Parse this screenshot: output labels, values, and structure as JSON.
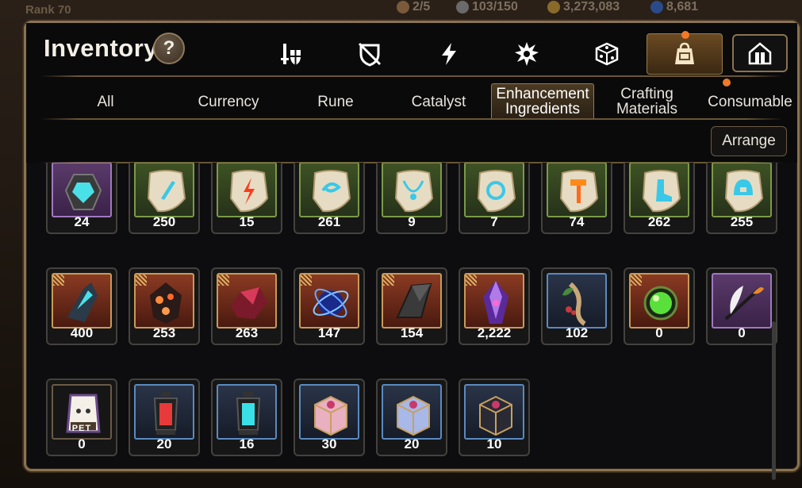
{
  "topbar": {
    "rank": "Rank 70",
    "keys": "2/5",
    "energy": "103/150",
    "silver": "3,273,083",
    "gems": "8,681"
  },
  "header": {
    "title": "Inventory",
    "help": "?"
  },
  "categories": [
    {
      "icon": "sword-shield-icon",
      "active": false
    },
    {
      "icon": "broken-shield-icon",
      "active": false
    },
    {
      "icon": "lightning-icon",
      "active": false
    },
    {
      "icon": "burst-icon",
      "active": false
    },
    {
      "icon": "dice-icon",
      "active": false
    },
    {
      "icon": "bag-icon",
      "active": true,
      "notification": true
    },
    {
      "icon": "house-icon",
      "active": false
    }
  ],
  "tabs": [
    {
      "label": "All",
      "active": false
    },
    {
      "label": "Currency",
      "active": false
    },
    {
      "label": "Rune",
      "active": false
    },
    {
      "label": "Catalyst",
      "active": false
    },
    {
      "label": "Enhancement Ingredients",
      "active": true
    },
    {
      "label": "Crafting Materials",
      "active": false
    },
    {
      "label": "Consumable",
      "active": false,
      "notification": true
    }
  ],
  "arrange": "Arrange",
  "items": [
    {
      "name": "purple-gem-icon",
      "count": "24",
      "frame": "purple"
    },
    {
      "name": "sword-rune-icon",
      "count": "250",
      "frame": "green"
    },
    {
      "name": "lightning-rune-icon",
      "count": "15",
      "frame": "green"
    },
    {
      "name": "swirl-rune-icon",
      "count": "261",
      "frame": "green"
    },
    {
      "name": "necklace-rune-icon",
      "count": "9",
      "frame": "green"
    },
    {
      "name": "ring-rune-icon",
      "count": "7",
      "frame": "green"
    },
    {
      "name": "hammer-rune-icon",
      "count": "74",
      "frame": "green"
    },
    {
      "name": "boot-rune-icon",
      "count": "262",
      "frame": "green"
    },
    {
      "name": "helmet-rune-icon",
      "count": "255",
      "frame": "green"
    },
    {
      "name": "dark-crystal-icon",
      "count": "400",
      "frame": "red"
    },
    {
      "name": "fire-core-icon",
      "count": "253",
      "frame": "red"
    },
    {
      "name": "crimson-crystal-icon",
      "count": "263",
      "frame": "red"
    },
    {
      "name": "arcane-orb-icon",
      "count": "147",
      "frame": "red"
    },
    {
      "name": "stone-shard-icon",
      "count": "154",
      "frame": "red"
    },
    {
      "name": "violet-crystal-icon",
      "count": "2,222",
      "frame": "red"
    },
    {
      "name": "herb-root-icon",
      "count": "102",
      "frame": "blue"
    },
    {
      "name": "green-orb-icon",
      "count": "0",
      "frame": "red"
    },
    {
      "name": "feather-quill-icon",
      "count": "0",
      "frame": "purple"
    },
    {
      "name": "pet-food-bag-icon",
      "count": "0",
      "frame": "hex",
      "label": "PET"
    },
    {
      "name": "red-lantern-icon",
      "count": "20",
      "frame": "blue"
    },
    {
      "name": "cyan-lantern-icon",
      "count": "16",
      "frame": "blue"
    },
    {
      "name": "pink-chest-icon",
      "count": "30",
      "frame": "blue"
    },
    {
      "name": "blue-chest-icon",
      "count": "20",
      "frame": "blue"
    },
    {
      "name": "black-chest-icon",
      "count": "10",
      "frame": "blue"
    }
  ],
  "colors": {
    "frame_border": "#8b7350",
    "tab_accent": "#c8a060",
    "notification": "#f07a28"
  }
}
